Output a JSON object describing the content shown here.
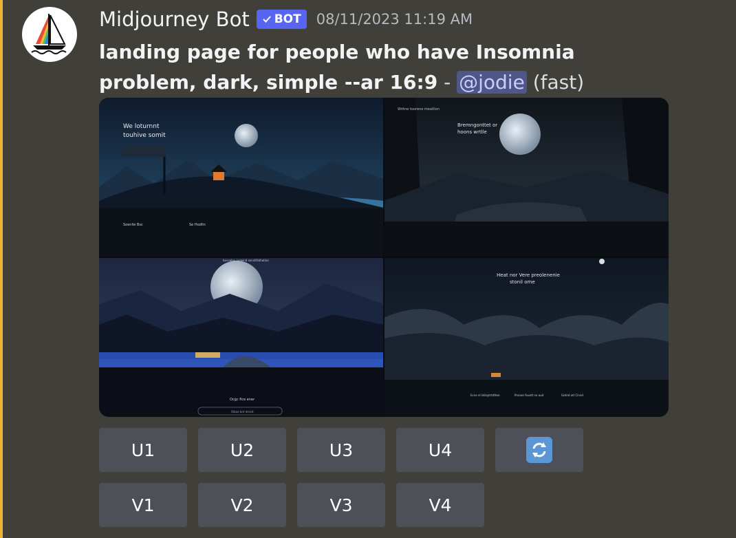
{
  "author": {
    "name": "Midjourney Bot",
    "badge": "BOT",
    "badge_icon": "checkmark-icon",
    "timestamp": "08/11/2023 11:19 AM",
    "avatar_icon": "sailboat-logo-icon"
  },
  "message": {
    "prompt": "landing page for people who have Insomnia problem, dark, simple --ar 16:9",
    "separator": "-",
    "mention": "@jodie",
    "mode": "(fast)"
  },
  "image": {
    "panels": [
      {
        "heading_line1": "We loturnnt",
        "heading_line2": "touhive somit",
        "section_a": "Soenlie Bsc",
        "section_b": "Se Hodlin"
      },
      {
        "top_text": "Writne toorene meatlion",
        "heading_line1": "Bremngonttet or",
        "heading_line2": "hoons wrtlle"
      },
      {
        "top_text": "bovvelay ovaeind sonnitfathation",
        "button_label": "Ocgc fice ener",
        "cta_text": "Stbae bnt deroit"
      },
      {
        "heading_line1": "Heat nor Vere preolenenie",
        "heading_line2": "stonil ome",
        "col1": "Ecne el lotioptrtdttee",
        "col2": "Pranoe fouett ne aud",
        "col3": "Gotnd art Cinnd"
      }
    ]
  },
  "buttons": {
    "upscale": [
      "U1",
      "U2",
      "U3",
      "U4"
    ],
    "variation": [
      "V1",
      "V2",
      "V3",
      "V4"
    ],
    "reroll_icon": "refresh-icon"
  },
  "colors": {
    "background": "#413f3a",
    "accent_bar": "#f0b232",
    "bot_badge": "#5865f2",
    "button": "#4e5058",
    "mention_bg": "#4f5789",
    "refresh_emoji": "#5b97d5"
  }
}
